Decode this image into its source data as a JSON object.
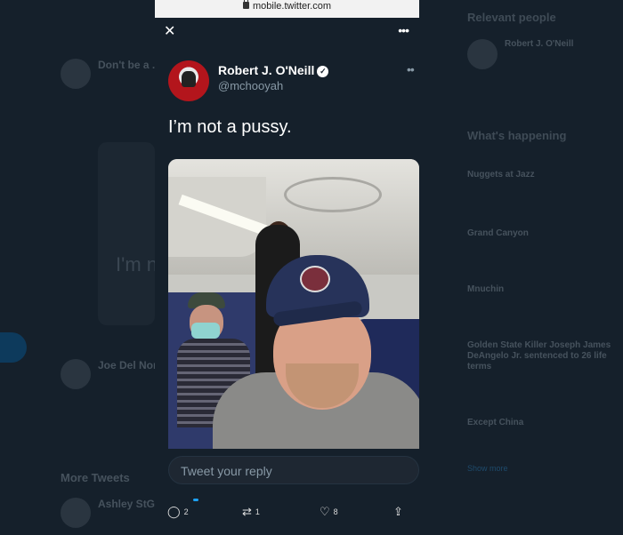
{
  "browser": {
    "url": "mobile.twitter.com"
  },
  "tweet": {
    "author_name": "Robert J. O'Neill",
    "author_handle": "@mchooyah",
    "text": "I’m not a pussy.",
    "reply_placeholder": "Tweet your reply",
    "counts": {
      "replies": "2",
      "retweets": "1",
      "likes": "8"
    }
  },
  "background": {
    "left_items": [
      "Don't be a ...",
      "Joe Del Nor...",
      "More Tweets",
      "Ashley StGi..."
    ],
    "card_text": "I'm n",
    "right": {
      "relevant_people_title": "Relevant people",
      "person_name": "Robert J. O'Neill",
      "whats_happening_title": "What's happening",
      "trends": [
        "Nuggets at Jazz",
        "Grand Canyon",
        "Mnuchin",
        "Golden State Killer Joseph James DeAngelo Jr. sentenced to 26 life terms",
        "Except China"
      ],
      "show_more": "Show more"
    }
  },
  "icons": {
    "close": "close-icon",
    "more": "more-icon",
    "verified": "verified-badge-icon",
    "reply": "reply-icon",
    "retweet": "retweet-icon",
    "like": "heart-icon",
    "share": "share-icon",
    "lock": "lock-icon"
  }
}
